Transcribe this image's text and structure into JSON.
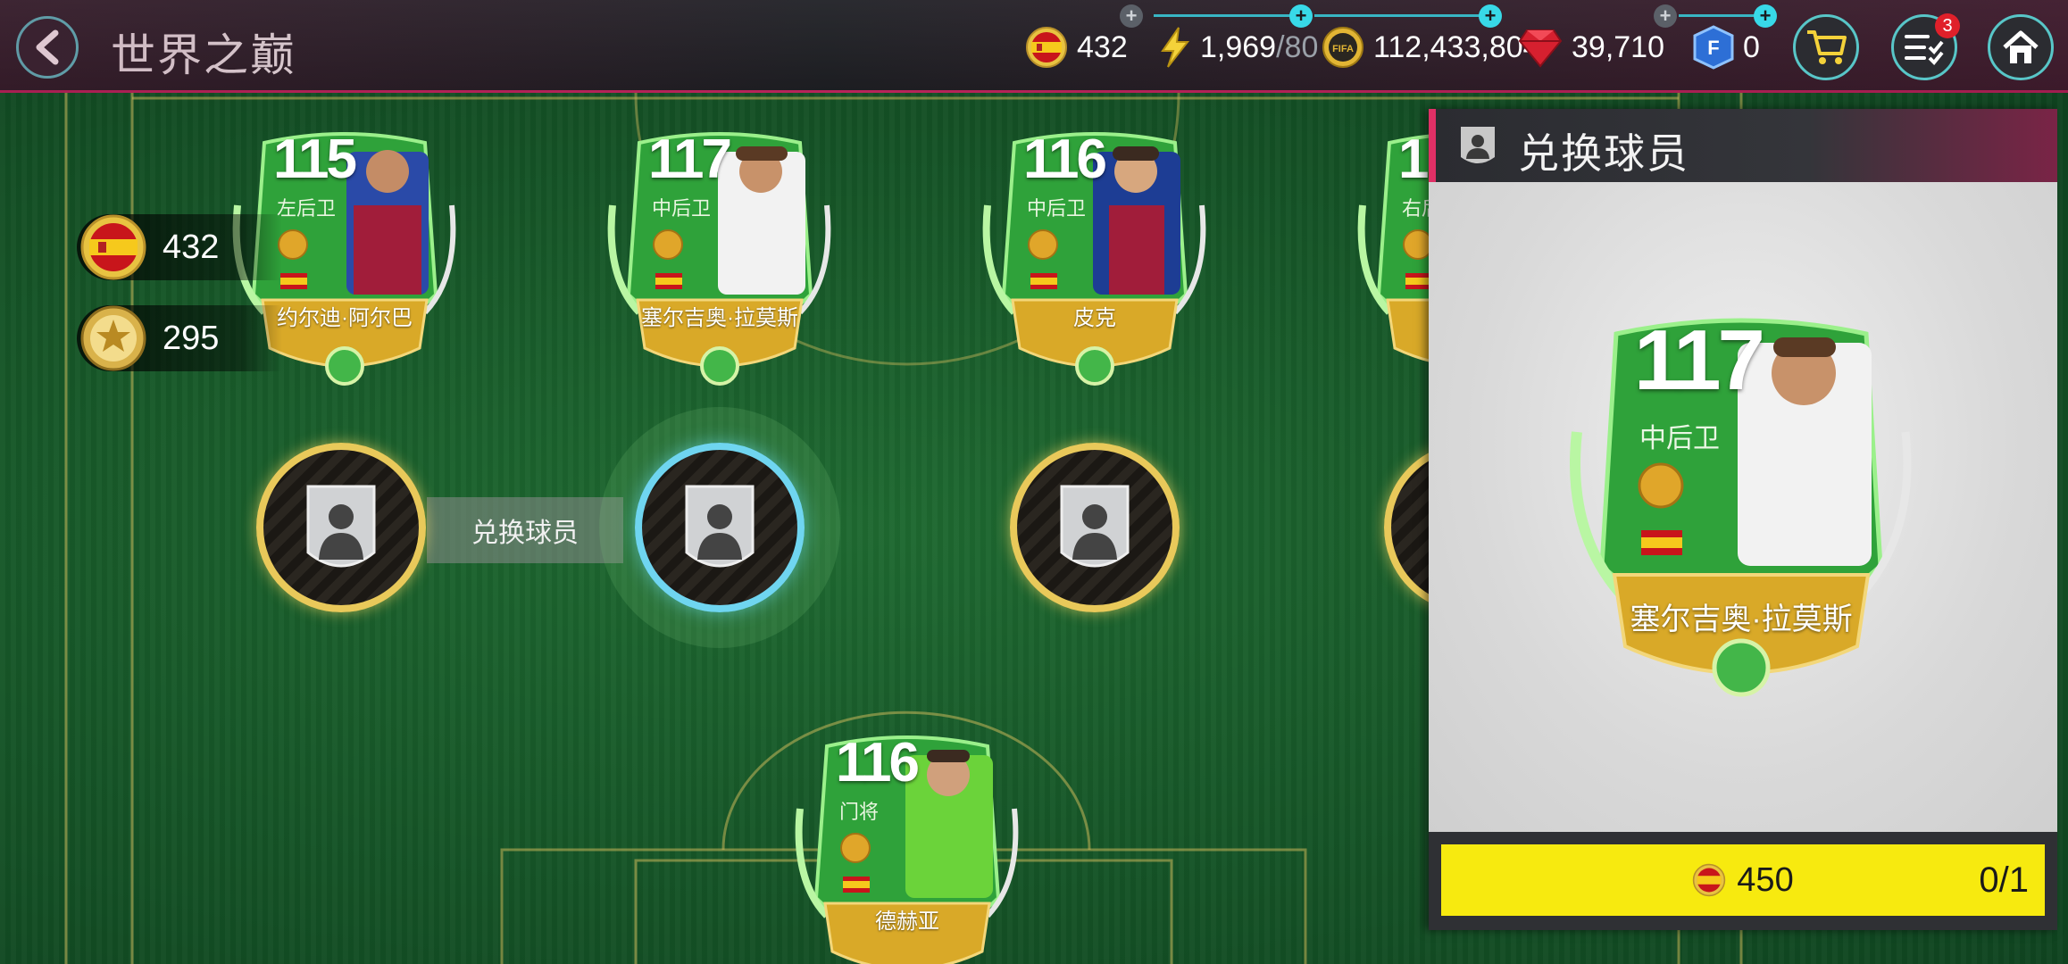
{
  "header": {
    "title": "世界之巅",
    "notification_count": "3"
  },
  "resources": {
    "spain_tokens": "432",
    "stamina": "1,969",
    "stamina_max": "/80",
    "coins": "112,433,804",
    "gems": "39,710",
    "fifa_points": "0"
  },
  "side_tokens": [
    {
      "icon": "spain-flag-token-icon",
      "value": "432"
    },
    {
      "icon": "world-tour-token-icon",
      "value": "295"
    }
  ],
  "players": [
    {
      "rating": "115",
      "position": "左后卫",
      "name": "约尔迪·阿尔巴"
    },
    {
      "rating": "117",
      "position": "中后卫",
      "name": "塞尔吉奥·拉莫斯"
    },
    {
      "rating": "116",
      "position": "中后卫",
      "name": "皮克"
    },
    {
      "rating": "1",
      "position": "右后",
      "name": ""
    },
    {
      "rating": "116",
      "position": "门将",
      "name": "德赫亚"
    }
  ],
  "exchange_tag": "兑换球员",
  "panel": {
    "title": "兑换球员",
    "card": {
      "rating": "117",
      "position": "中后卫",
      "name": "塞尔吉奥·拉莫斯"
    },
    "price": "450",
    "count": "0/1"
  },
  "colors": {
    "accent_cyan": "#38d9e8",
    "header_accent": "#e03066",
    "buy_button": "#f7ea0f",
    "card_green": "#2fa23a",
    "card_gold": "#d9a928"
  }
}
